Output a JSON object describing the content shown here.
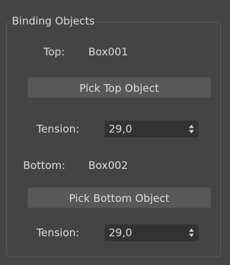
{
  "group": {
    "title": "Binding Objects"
  },
  "top": {
    "label": "Top:",
    "value": "Box001",
    "pick_button": "Pick Top Object",
    "tension_label": "Tension:",
    "tension_value": "29,0"
  },
  "bottom": {
    "label": "Bottom:",
    "value": "Box002",
    "pick_button": "Pick Bottom Object",
    "tension_label": "Tension:",
    "tension_value": "29,0"
  },
  "icons": {
    "spinner": "spinner-arrows-icon"
  },
  "colors": {
    "panel_bg": "#444444",
    "button_bg": "#585858",
    "field_bg": "#333333",
    "text": "#dcdcdc"
  }
}
